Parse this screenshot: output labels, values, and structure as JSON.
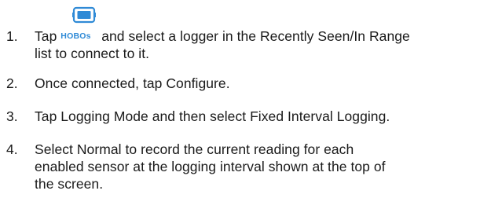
{
  "icon": {
    "name": "hobos-logger-icon",
    "color": "#2f8ad6"
  },
  "steps": [
    {
      "number": "1.",
      "before": "Tap",
      "button_label": "HOBOs",
      "after_line1": "and select a logger in the Recently Seen/In Range",
      "line2": "list to connect to it."
    },
    {
      "number": "2.",
      "text": "Once connected, tap Configure."
    },
    {
      "number": "3.",
      "text": "Tap Logging Mode and then select Fixed Interval Logging."
    },
    {
      "number": "4.",
      "line1": "Select Normal to record the current reading for each",
      "line2": "enabled sensor at the logging interval shown at the top of",
      "line3": "the screen."
    }
  ]
}
